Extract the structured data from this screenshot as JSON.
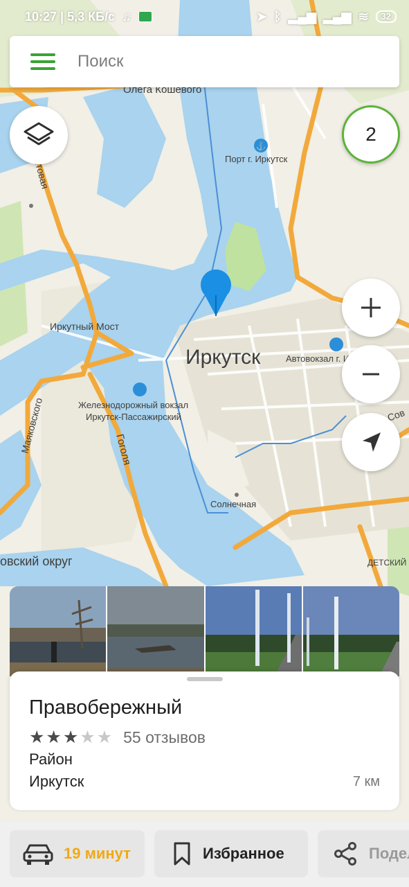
{
  "status_bar": {
    "time_speed": "10:27 | 5,3 КБ/с",
    "battery": "32"
  },
  "search": {
    "placeholder": "Поиск"
  },
  "map": {
    "badge_count": "2",
    "labels": {
      "city": "Иркутск",
      "olega_koshevogo": "Олега Кошевого",
      "port": "Порт г. Иркутск",
      "ktovaya": "ктовая",
      "irkutny_most": "Иркутный Мост",
      "avtovokzal": "Автовокзал г. Иркутск",
      "rail_station_1": "Железнодорожный вокзал",
      "rail_station_2": "Иркутск-Пассажирский",
      "mayakovskogo": "Маяковского",
      "gogolya": "Гоголя",
      "solnechnaya": "Солнечная",
      "okrug": "овский округ",
      "detsky": "ДЕТСКИЙ",
      "sov": "Сов"
    },
    "colors": {
      "water": "#a9d3ee",
      "land": "#f1efe6",
      "road_major": "#f2a93b",
      "park": "#bfe2a1",
      "pin": "#1a8fe3",
      "accent_green": "#3aa335"
    }
  },
  "card": {
    "name": "Правобережный",
    "rating": 3,
    "rating_max": 5,
    "reviews": "55 отзывов",
    "type": "Район",
    "city": "Иркутск",
    "distance": "7 км"
  },
  "actions": {
    "route": "19 минут",
    "favorites": "Избранное",
    "share": "Поделиться"
  }
}
